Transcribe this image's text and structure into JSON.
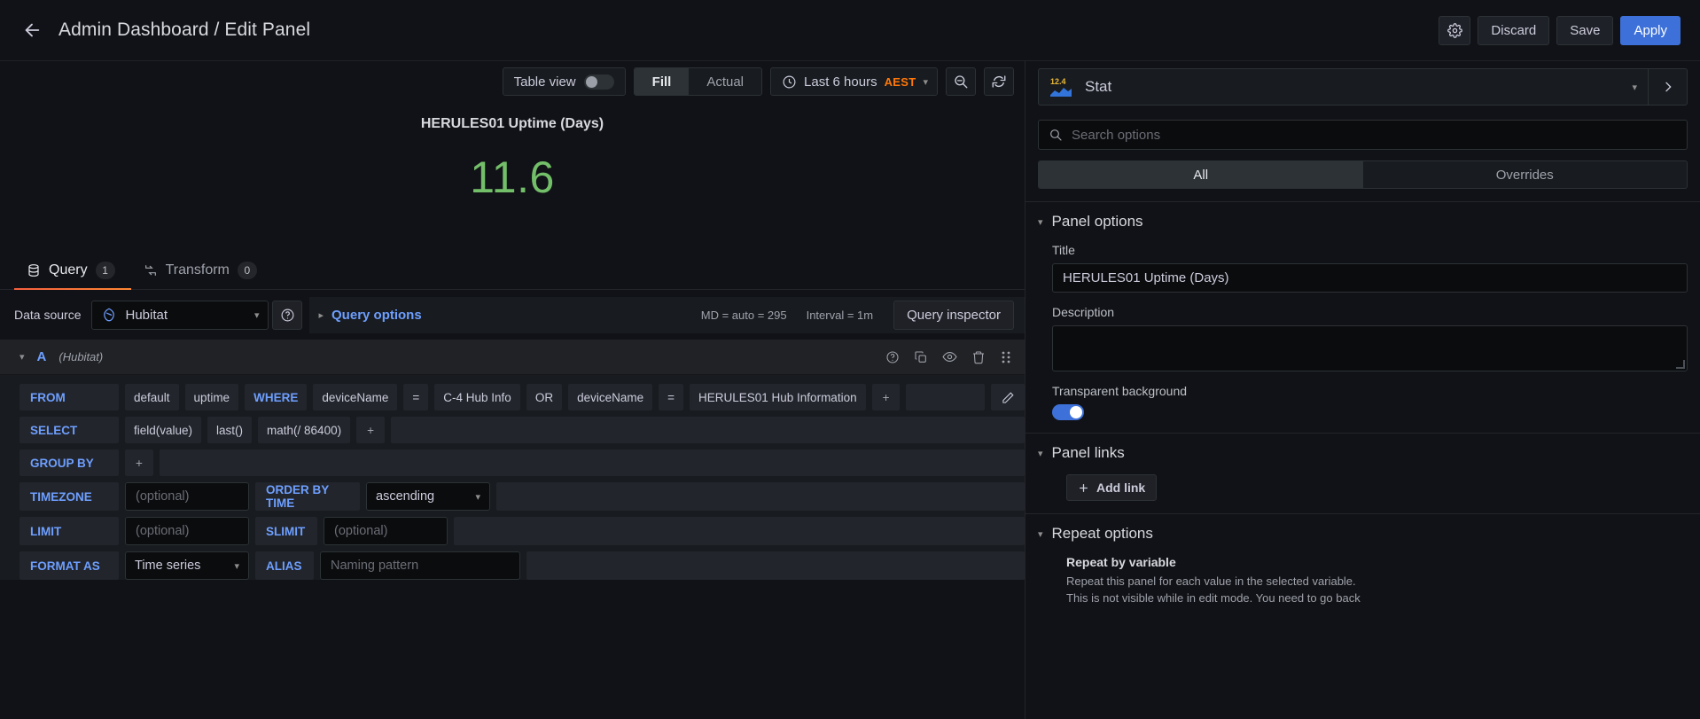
{
  "topbar": {
    "back_icon": "arrow-left-icon",
    "breadcrumb": "Admin Dashboard / Edit Panel",
    "settings_icon": "gear-icon",
    "discard_label": "Discard",
    "save_label": "Save",
    "apply_label": "Apply",
    "accent_primary": "#3d71d9"
  },
  "viz_toolbar": {
    "table_view_label": "Table view",
    "table_view_on": false,
    "fill_label": "Fill",
    "actual_label": "Actual",
    "fill_active": true,
    "time_icon": "clock-icon",
    "time_range": "Last 6 hours",
    "timezone": "AEST",
    "timezone_color": "#ff780a",
    "zoom_out_icon": "zoom-out-icon",
    "refresh_icon": "refresh-icon"
  },
  "preview": {
    "panel_title": "HERULES01 Uptime (Days)",
    "stat_value": "11.6",
    "stat_color": "#73bf69"
  },
  "query_tabs": [
    {
      "label": "Query",
      "count": "1",
      "icon": "database-icon",
      "active": true
    },
    {
      "label": "Transform",
      "count": "0",
      "icon": "transform-icon",
      "active": false
    }
  ],
  "datasource_row": {
    "label": "Data source",
    "icon": "hubitat-icon",
    "value": "Hubitat",
    "help_icon": "question-circle-icon",
    "query_options_label": "Query options",
    "md_info": "MD = auto = 295",
    "interval_info": "Interval = 1m",
    "query_inspector_label": "Query inspector"
  },
  "query_card": {
    "ref_id": "A",
    "datasource": "(Hubitat)",
    "tools": [
      "help-icon",
      "duplicate-icon",
      "eye-icon",
      "trash-icon",
      "drag-handle-icon"
    ],
    "pencil_icon": "pencil-icon",
    "rows": {
      "from": {
        "key": "FROM",
        "retention": "default",
        "measurement": "uptime",
        "where_kw": "WHERE",
        "cond1_field": "deviceName",
        "cond1_op": "=",
        "cond1_value": "C-4 Hub Info",
        "conjunction": "OR",
        "cond2_field": "deviceName",
        "cond2_op": "=",
        "cond2_value": "HERULES01 Hub Information",
        "add": "+"
      },
      "select": {
        "key": "SELECT",
        "field": "field(value)",
        "aggregate": "last()",
        "math": "math(/ 86400)",
        "add": "+"
      },
      "group_by": {
        "key": "GROUP BY",
        "add": "+"
      },
      "timezone": {
        "key": "TIMEZONE",
        "placeholder": "(optional)",
        "order_key": "ORDER BY TIME",
        "order_value": "ascending"
      },
      "limit": {
        "key": "LIMIT",
        "placeholder": "(optional)",
        "slimit_key": "SLIMIT",
        "slimit_placeholder": "(optional)"
      },
      "format": {
        "key": "FORMAT AS",
        "value": "Time series",
        "alias_key": "ALIAS",
        "alias_placeholder": "Naming pattern"
      }
    }
  },
  "options_pane": {
    "viz_icon_value": "12.4",
    "viz_name": "Stat",
    "viz_chevron_icon": "chevron-down-icon",
    "viz_next_icon": "chevron-right-icon",
    "search_icon": "search-icon",
    "search_placeholder": "Search options",
    "tabs": [
      {
        "label": "All",
        "active": true
      },
      {
        "label": "Overrides",
        "active": false
      }
    ],
    "panel_options": {
      "title": "Panel options",
      "title_label": "Title",
      "title_value": "HERULES01 Uptime (Days)",
      "description_label": "Description",
      "description_value": "",
      "transparent_label": "Transparent background",
      "transparent_on": true
    },
    "panel_links": {
      "title": "Panel links",
      "add_link_label": "Add link",
      "add_icon": "plus-icon"
    },
    "repeat_options": {
      "title": "Repeat options",
      "repeat_label": "Repeat by variable",
      "repeat_desc_line1": "Repeat this panel for each value in the selected variable.",
      "repeat_desc_line2": "This is not visible while in edit mode. You need to go back"
    }
  }
}
